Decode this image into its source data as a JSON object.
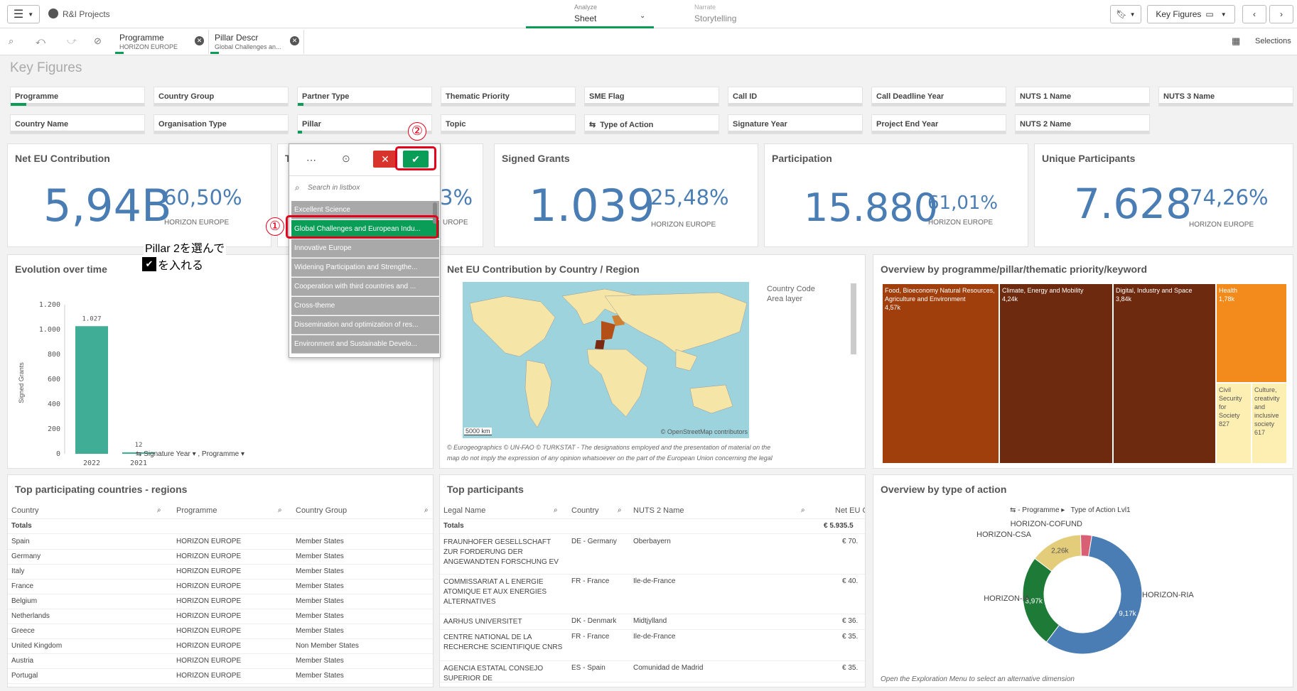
{
  "app": {
    "title": "R&I Projects",
    "analyze_label": "Analyze",
    "analyze_value": "Sheet",
    "narrate_label": "Narrate",
    "narrate_value": "Storytelling",
    "sheet_name": "Key Figures",
    "selections": "Selections"
  },
  "chips": [
    {
      "label": "Programme",
      "value": "HORIZON EUROPE"
    },
    {
      "label": "Pillar Descr",
      "value": "Global Challenges an..."
    }
  ],
  "page_title": "Key Figures",
  "filters_row1": [
    "Programme",
    "Country Group",
    "Partner Type",
    "Thematic Priority",
    "SME Flag",
    "Call ID",
    "Call Deadline Year",
    "NUTS 1 Name",
    "NUTS 3 Name"
  ],
  "filters_row2": [
    "Country Name",
    "Organisation Type",
    "Pillar",
    "Topic",
    "Type of Action",
    "Signature Year",
    "Project End Year",
    "NUTS 2 Name"
  ],
  "kpis": [
    {
      "title": "Net EU Contribution",
      "value": "5,94B",
      "pct": "60,50%",
      "sub": "HORIZON EUROPE"
    },
    {
      "title": "T",
      "value": "",
      "pct": "3%",
      "sub": "UROPE"
    },
    {
      "title": "Signed Grants",
      "value": "1.039",
      "pct": "25,48%",
      "sub": "HORIZON EUROPE"
    },
    {
      "title": "Participation",
      "value": "15.880",
      "pct": "61,01%",
      "sub": "HORIZON EUROPE"
    },
    {
      "title": "Unique Participants",
      "value": "7.628",
      "pct": "74,26%",
      "sub": "HORIZON EUROPE"
    }
  ],
  "dropdown": {
    "search_placeholder": "Search in listbox",
    "items": [
      "Excellent Science",
      "Global Challenges and European Indu...",
      "Innovative Europe",
      "Widening Participation and Strengthe...",
      "Cooperation with third countries and ...",
      "Cross-theme",
      "Dissemination and optimization of res...",
      "Environment and Sustainable Develo..."
    ],
    "selected_index": 1
  },
  "annotation": {
    "num1": "①",
    "num2": "②",
    "line1": "Pillar 2を選んで",
    "line2": "を入れる"
  },
  "evolution": {
    "title": "Evolution over time",
    "ylabel": "Signed Grants",
    "xcontrol": "Signature Year",
    "xcontrol2": ", Programme",
    "chart_data": {
      "type": "bar",
      "categories": [
        "2022",
        "2021"
      ],
      "values": [
        1027,
        12
      ],
      "ylim": [
        0,
        1200
      ],
      "yticks": [
        "0",
        "200",
        "400",
        "600",
        "800",
        "1.000",
        "1.200"
      ],
      "labels": [
        "1.027",
        "12"
      ]
    }
  },
  "map": {
    "title": "Net EU Contribution by Country / Region",
    "legend1": "Country Code",
    "legend2": "Area layer",
    "scale": "5000 km",
    "credit": "© OpenStreetMap contributors",
    "disclaimer1": "© Eurogeographics © UN-FAO © TURKSTAT - The designations employed and the presentation of material on the",
    "disclaimer2": "map do not imply the expression of any opinion whatsoever on the part of the European Union concerning the legal"
  },
  "treemap": {
    "title": "Overview by programme/pillar/thematic priority/keyword",
    "chart_data": {
      "type": "treemap",
      "items": [
        {
          "label": "Food, Bioeconomy Natural Resources, Agriculture and Environment",
          "value": "4,57k"
        },
        {
          "label": "Climate, Energy and Mobility",
          "value": "4,24k"
        },
        {
          "label": "Digital, Industry and Space",
          "value": "3,84k"
        },
        {
          "label": "Health",
          "value": "1,78k"
        },
        {
          "label": "Civil Security for Society",
          "value": "827"
        },
        {
          "label": "Culture, creativity and inclusive society",
          "value": "617"
        }
      ]
    }
  },
  "countries": {
    "title": "Top participating countries - regions",
    "headers": [
      "Country",
      "Programme",
      "Country Group"
    ],
    "totals": "Totals",
    "rows": [
      [
        "Spain",
        "HORIZON EUROPE",
        "Member States"
      ],
      [
        "Germany",
        "HORIZON EUROPE",
        "Member States"
      ],
      [
        "Italy",
        "HORIZON EUROPE",
        "Member States"
      ],
      [
        "France",
        "HORIZON EUROPE",
        "Member States"
      ],
      [
        "Belgium",
        "HORIZON EUROPE",
        "Member States"
      ],
      [
        "Netherlands",
        "HORIZON EUROPE",
        "Member States"
      ],
      [
        "Greece",
        "HORIZON EUROPE",
        "Member States"
      ],
      [
        "United Kingdom",
        "HORIZON EUROPE",
        "Non Member States"
      ],
      [
        "Austria",
        "HORIZON EUROPE",
        "Member States"
      ],
      [
        "Portugal",
        "HORIZON EUROPE",
        "Member States"
      ]
    ]
  },
  "participants": {
    "title": "Top participants",
    "headers": [
      "Legal Name",
      "Country",
      "NUTS 2 Name",
      "Net EU C"
    ],
    "totals": "Totals",
    "total_value": "€ 5.935.5",
    "rows": [
      [
        "FRAUNHOFER GESELLSCHAFT ZUR FORDERUNG DER ANGEWANDTEN FORSCHUNG EV",
        "DE - Germany",
        "Oberbayern",
        "€ 70."
      ],
      [
        "COMMISSARIAT A L ENERGIE ATOMIQUE ET AUX ENERGIES ALTERNATIVES",
        "FR - France",
        "Ile-de-France",
        "€ 40."
      ],
      [
        "AARHUS UNIVERSITET",
        "DK - Denmark",
        "Midtjylland",
        "€ 36."
      ],
      [
        "CENTRE NATIONAL DE LA RECHERCHE SCIENTIFIQUE CNRS",
        "FR - France",
        "Ile-de-France",
        "€ 35."
      ],
      [
        "AGENCIA ESTATAL CONSEJO SUPERIOR DE",
        "ES - Spain",
        "Comunidad de Madrid",
        "€ 35."
      ]
    ]
  },
  "action": {
    "title": "Overview by type of action",
    "control1": "- Programme",
    "control2": "Type of Action Lvl1",
    "footer": "Open the Exploration Menu to select an alternative dimension",
    "chart_data": {
      "type": "pie",
      "slices": [
        {
          "name": "HORIZON-RIA",
          "value": 9170,
          "label": "9,17k"
        },
        {
          "name": "HORIZON-IA",
          "value": 3970,
          "label": "3,97k"
        },
        {
          "name": "HORIZON-CSA",
          "value": 2260,
          "label": "2,26k"
        },
        {
          "name": "HORIZON-COFUND",
          "value": 480,
          "label": ""
        }
      ]
    }
  },
  "colors": {
    "accent": "#0a9d58",
    "kpi": "#4a7db3",
    "bar": "#40ae96",
    "red": "#e2001a"
  }
}
